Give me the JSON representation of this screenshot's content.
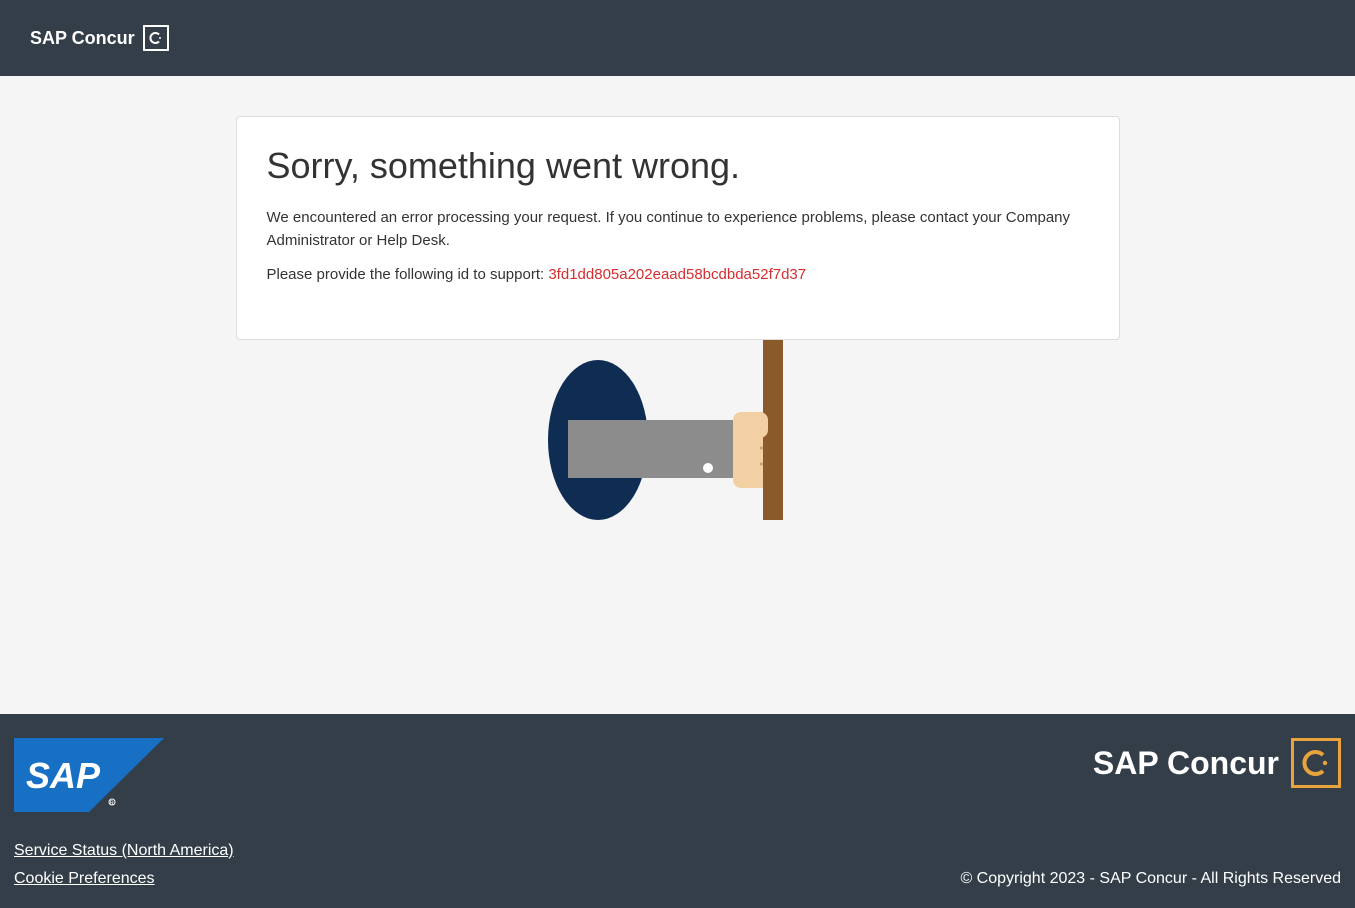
{
  "header": {
    "brand": "SAP Concur"
  },
  "error": {
    "title": "Sorry, something went wrong.",
    "message": "We encountered an error processing your request. If you continue to experience problems, please contact your Company Administrator or Help Desk.",
    "id_prompt": "Please provide the following id to support: ",
    "id": "3fd1dd805a202eaad58bcdbda52f7d37"
  },
  "footer": {
    "brand": "SAP Concur",
    "links": {
      "service_status": "Service Status (North America)",
      "cookie_prefs": "Cookie Preferences"
    },
    "copyright": "© Copyright 2023 - SAP Concur - All Rights Reserved"
  }
}
